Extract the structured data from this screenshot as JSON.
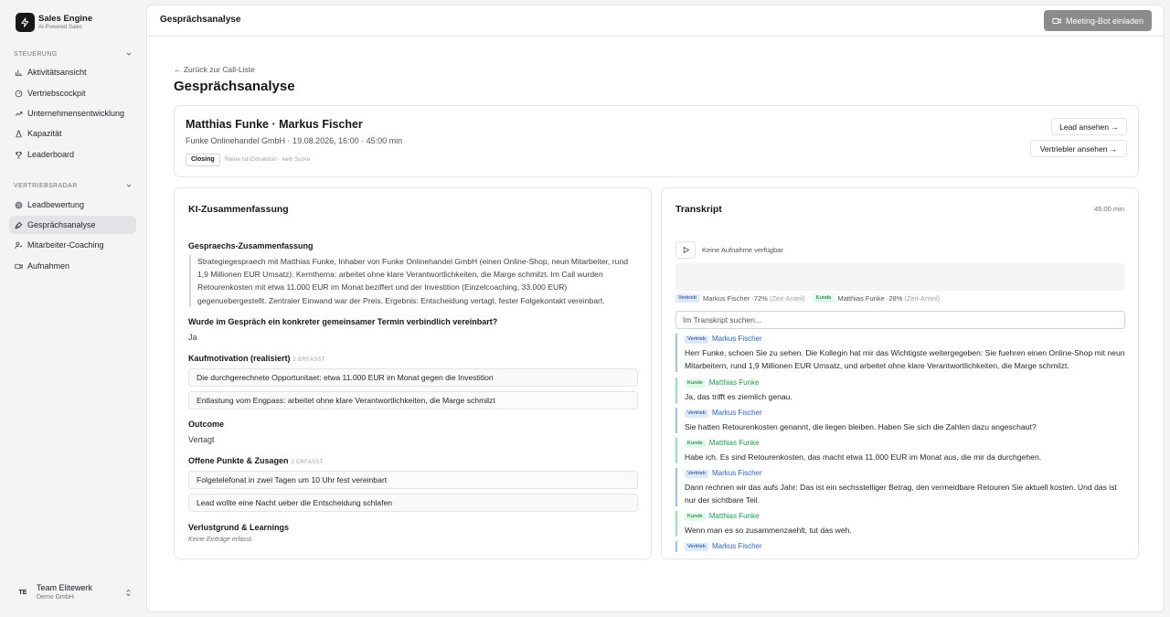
{
  "brand": {
    "name": "Sales Engine",
    "tagline": "AI-Powered Sales"
  },
  "sidebar": {
    "section1": {
      "label": "STEUERUNG",
      "items": [
        {
          "label": "Aktivitätsansicht",
          "icon": "bar-chart-icon"
        },
        {
          "label": "Vertriebscockpit",
          "icon": "gauge-icon"
        },
        {
          "label": "Unternehmensentwicklung",
          "icon": "trending-up-icon"
        },
        {
          "label": "Kapazität",
          "icon": "flask-icon"
        },
        {
          "label": "Leaderboard",
          "icon": "trophy-icon"
        }
      ]
    },
    "section2": {
      "label": "VERTRIEBSRADAR",
      "items": [
        {
          "label": "Leadbewertung",
          "icon": "target-icon"
        },
        {
          "label": "Gesprächsanalyse",
          "icon": "mic-icon",
          "active": true
        },
        {
          "label": "Mitarbeiter-Coaching",
          "icon": "user-coach-icon"
        },
        {
          "label": "Aufnahmen",
          "icon": "video-icon"
        }
      ]
    },
    "team": {
      "initials": "TE",
      "name": "Team Elitewerk",
      "company": "Demo GmbH"
    }
  },
  "topbar": {
    "title": "Gesprächsanalyse",
    "bot_button": "Meeting-Bot einladen"
  },
  "page": {
    "back_link": "← Zurück zur Call-Liste",
    "title": "Gesprächsanalyse"
  },
  "call": {
    "participants": "Matthias Funke · Markus Fischer",
    "meta": "Funke Onlinehandel GmbH · 19.08.2026, 16:00 · 45:00 min",
    "tag": "Closing",
    "note": "Reine Ist-Extraktion · kein Score",
    "lead_button": "Lead ansehen →",
    "rep_button": "Vertriebler ansehen →"
  },
  "summary": {
    "title": "KI-Zusammenfassung",
    "overview_label": "Gespraechs-Zusammenfassung",
    "overview_text": "Strategiegespraech mit Matthias Funke, Inhaber von Funke Onlinehandel GmbH (einen Online-Shop, neun Mitarbeiter, rund 1,9 Millionen EUR Umsatz). Kernthema: arbeitet ohne klare Verantwortlichkeiten, die Marge schmilzt. Im Call wurden Retourenkosten mit etwa 11.000 EUR im Monat beziffert und der Investition (Einzelcoaching, 33.000 EUR) gegenuebergestellt. Zentraler Einwand war der Preis. Ergebnis: Entscheidung vertagt, fester Folgekontakt vereinbart.",
    "appointment_label": "Wurde im Gespräch ein konkreter gemeinsamer Termin verbindlich vereinbart?",
    "appointment_value": "Ja",
    "motivation_label": "Kaufmotivation (realisiert)",
    "motivation_count": "2 ERFASST",
    "motivation_items": [
      "Die durchgerechnete Opportunitaet: etwa 11.000 EUR im Monat gegen die Investition",
      "Entlastung vom Engpass: arbeitet ohne klare Verantwortlichkeiten, die Marge schmilzt"
    ],
    "outcome_label": "Outcome",
    "outcome_value": "Vertagt",
    "open_label": "Offene Punkte & Zusagen",
    "open_count": "2 ERFASST",
    "open_items": [
      "Folgetelefonat in zwei Tagen um 10 Uhr fest vereinbart",
      "Lead wollte eine Nacht ueber die Entscheidung schlafen"
    ],
    "loss_label": "Verlustgrund & Learnings",
    "loss_empty": "Keine Einträge erfasst."
  },
  "transcript": {
    "title": "Transkript",
    "duration": "45:00 min",
    "no_recording": "Keine Aufnahme verfügbar",
    "share": {
      "rep_badge": "Vertrieb",
      "rep_name": "Markus Fischer",
      "rep_pct": "72%",
      "rep_suffix": "(Zeit-Anteil)",
      "cust_badge": "Kunde",
      "cust_name": "Matthias Funke",
      "cust_pct": "28%",
      "cust_suffix": "(Zeit-Anteil)"
    },
    "search_placeholder": "Im Transkript suchen...",
    "messages": [
      {
        "role": "Vertrieb",
        "speaker": "Markus Fischer",
        "text": "Herr Funke, schoen Sie zu sehen. Die Kollegin hat mir das Wichtigste weitergegeben: Sie fuehren einen Online-Shop mit neun Mitarbeitern, rund 1,9 Millionen EUR Umsatz, und arbeitet ohne klare Verantwortlichkeiten, die Marge schmilzt."
      },
      {
        "role": "Kunde",
        "speaker": "Matthias Funke",
        "text": "Ja, das trifft es ziemlich genau."
      },
      {
        "role": "Vertrieb",
        "speaker": "Markus Fischer",
        "text": "Sie hatten Retourenkosten genannt, die liegen bleiben. Haben Sie sich die Zahlen dazu angeschaut?"
      },
      {
        "role": "Kunde",
        "speaker": "Matthias Funke",
        "text": "Habe ich. Es sind Retourenkosten, das macht etwa 11.000 EUR im Monat aus, die mir da durchgehen."
      },
      {
        "role": "Vertrieb",
        "speaker": "Markus Fischer",
        "text": "Dann rechnen wir das aufs Jahr: Das ist ein sechsstelliger Betrag, den vermeidbare Retouren Sie aktuell kosten. Und das ist nur der sichtbare Teil."
      },
      {
        "role": "Kunde",
        "speaker": "Matthias Funke",
        "text": "Wenn man es so zusammenzaehlt, tut das weh."
      },
      {
        "role": "Vertrieb",
        "speaker": "Markus Fischer",
        "text": ""
      }
    ]
  }
}
